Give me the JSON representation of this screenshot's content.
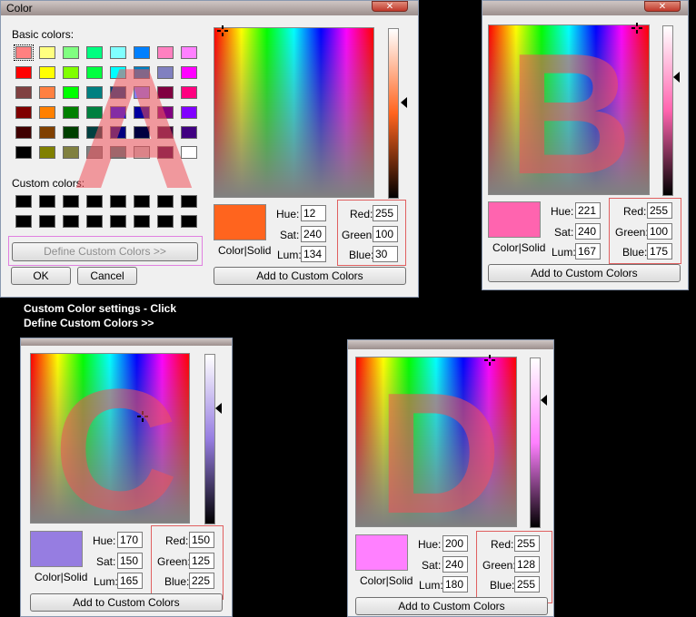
{
  "panel_a": {
    "title": "Color",
    "close": "✕",
    "basic_colors_label": "Basic colors:",
    "custom_colors_label": "Custom colors:",
    "define_custom_colors": "Define Custom Colors >>",
    "ok": "OK",
    "cancel": "Cancel",
    "color_solid": "Color|Solid",
    "add_custom": "Add to Custom Colors",
    "hue_label": "Hue:",
    "sat_label": "Sat:",
    "lum_label": "Lum:",
    "red_label": "Red:",
    "green_label": "Green:",
    "blue_label": "Blue:",
    "hue": "12",
    "sat": "240",
    "lum": "134",
    "red": "255",
    "green": "100",
    "blue": "30",
    "swatch_color": "#ff641e",
    "letter": "A",
    "basic_colors": [
      "#ff8080",
      "#ffff80",
      "#80ff80",
      "#00ff80",
      "#80ffff",
      "#0080ff",
      "#ff80c0",
      "#ff80ff",
      "#ff0000",
      "#ffff00",
      "#80ff00",
      "#00ff40",
      "#00ffff",
      "#0080c0",
      "#8080c0",
      "#ff00ff",
      "#804040",
      "#ff8040",
      "#00ff00",
      "#008080",
      "#004080",
      "#8080ff",
      "#800040",
      "#ff0080",
      "#800000",
      "#ff8000",
      "#008000",
      "#008040",
      "#0000ff",
      "#0000a0",
      "#800080",
      "#8000ff",
      "#400000",
      "#804000",
      "#004000",
      "#004040",
      "#000080",
      "#000040",
      "#400040",
      "#400080",
      "#000000",
      "#808000",
      "#808040",
      "#808080",
      "#408080",
      "#c0c0c0",
      "#400040",
      "#ffffff"
    ]
  },
  "panel_b": {
    "close": "✕",
    "color_solid": "Color|Solid",
    "add_custom": "Add to Custom Colors",
    "hue_label": "Hue:",
    "sat_label": "Sat:",
    "lum_label": "Lum:",
    "red_label": "Red:",
    "green_label": "Green:",
    "blue_label": "Blue:",
    "hue": "221",
    "sat": "240",
    "lum": "167",
    "red": "255",
    "green": "100",
    "blue": "175",
    "swatch_color": "#ff64af",
    "letter": "B"
  },
  "caption": {
    "line1": "Custom Color settings - Click",
    "line2": "Define Custom Colors >>"
  },
  "panel_c": {
    "color_solid": "Color|Solid",
    "add_custom": "Add to Custom Colors",
    "hue_label": "Hue:",
    "sat_label": "Sat:",
    "lum_label": "Lum:",
    "red_label": "Red:",
    "green_label": "Green:",
    "blue_label": "Blue:",
    "hue": "170",
    "sat": "150",
    "lum": "165",
    "red": "150",
    "green": "125",
    "blue": "225",
    "swatch_color": "#967de1",
    "letter": "C"
  },
  "panel_d": {
    "color_solid": "Color|Solid",
    "add_custom": "Add to Custom Colors",
    "hue_label": "Hue:",
    "sat_label": "Sat:",
    "lum_label": "Lum:",
    "red_label": "Red:",
    "green_label": "Green:",
    "blue_label": "Blue:",
    "hue": "200",
    "sat": "240",
    "lum": "180",
    "red": "255",
    "green": "128",
    "blue": "255",
    "swatch_color": "#ff80ff",
    "letter": "D"
  }
}
